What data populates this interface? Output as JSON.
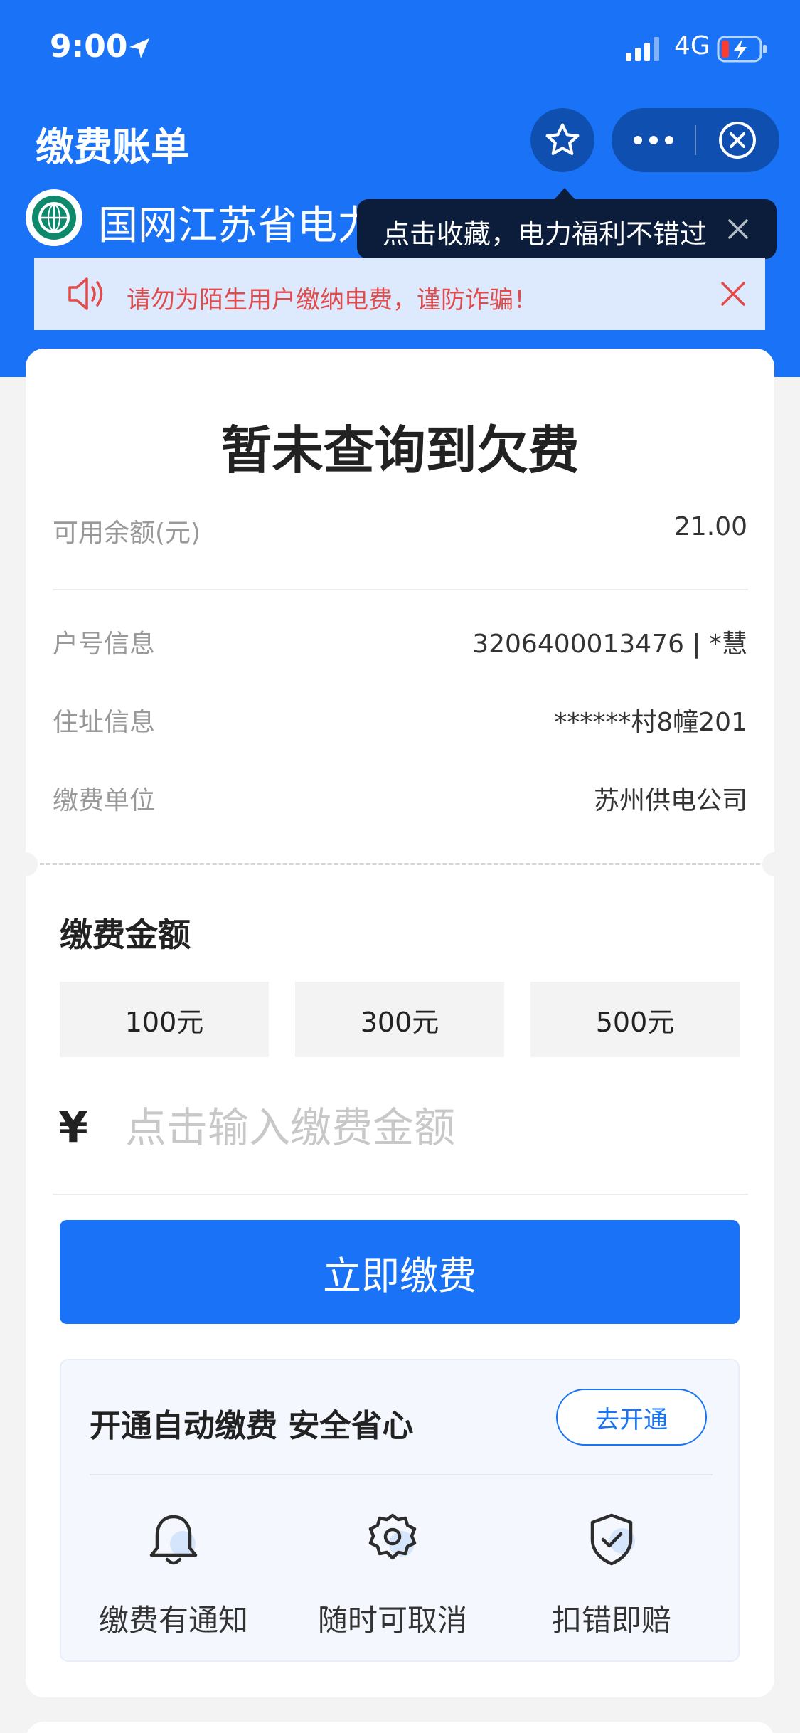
{
  "status_bar": {
    "time": "9:00",
    "network": "4G"
  },
  "nav": {
    "title": "缴费账单"
  },
  "company": {
    "name": "国网江苏省电力有限公司"
  },
  "tooltip": {
    "text": "点击收藏，电力福利不错过"
  },
  "warning": {
    "text": "请勿为陌生用户缴纳电费，谨防诈骗！"
  },
  "bill": {
    "headline": "暂未查询到欠费",
    "balance_label": "可用余额(元)",
    "balance_value": "21.00",
    "account_label": "户号信息",
    "account_value": "3206400013476 | *慧",
    "address_label": "住址信息",
    "address_value": "******村8幢201",
    "unit_label": "缴费单位",
    "unit_value": "苏州供电公司"
  },
  "payment": {
    "section_title": "缴费金额",
    "options": [
      "100元",
      "300元",
      "500元"
    ],
    "currency": "¥",
    "placeholder": "点击输入缴费金额",
    "submit_label": "立即缴费"
  },
  "auto_pay": {
    "title": "开通自动缴费  安全省心",
    "open_label": "去开通",
    "features": [
      {
        "icon": "bell-icon",
        "label": "缴费有通知"
      },
      {
        "icon": "gear-icon",
        "label": "随时可取消"
      },
      {
        "icon": "shield-check-icon",
        "label": "扣错即赔"
      }
    ]
  },
  "colors": {
    "primary": "#1a72f6",
    "warning_text": "#e14b4b",
    "tooltip_bg": "#0b1d3a"
  }
}
